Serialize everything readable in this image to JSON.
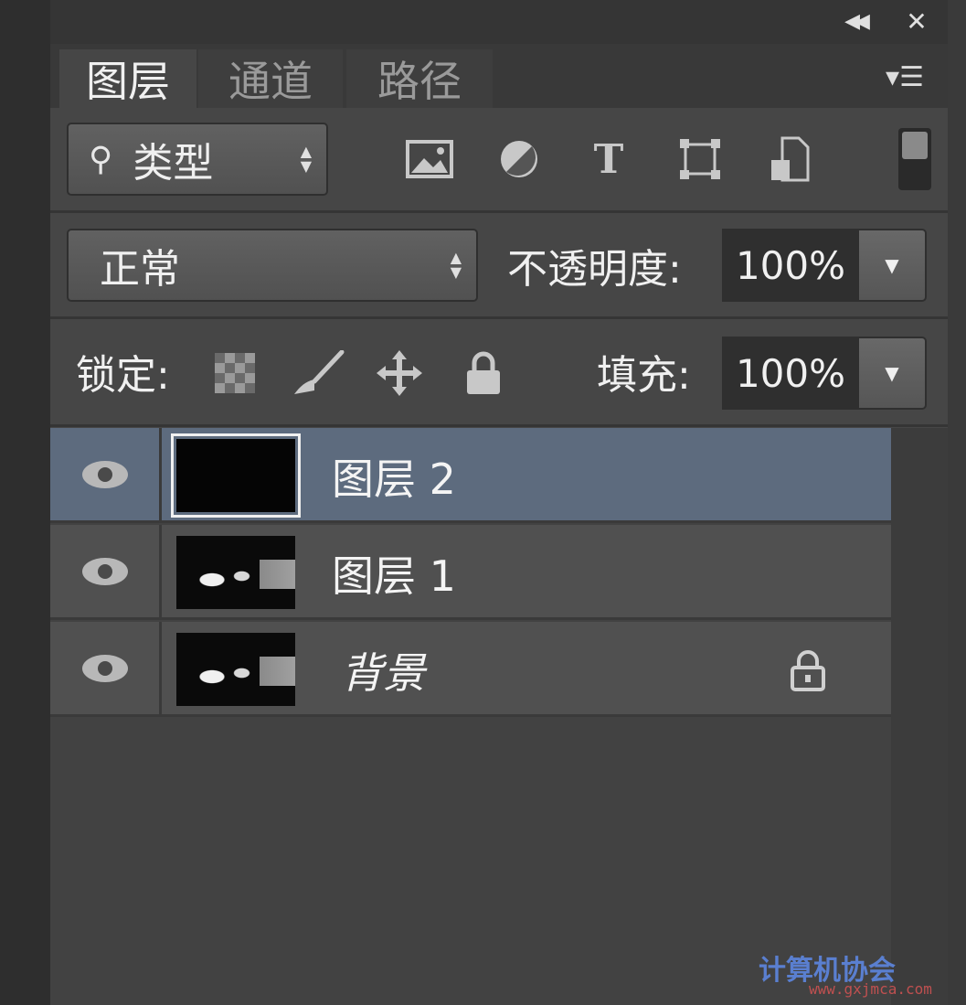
{
  "titlebar": {
    "collapse_glyph": "◀◀",
    "close_glyph": "✕"
  },
  "tabs": [
    {
      "label": "图层",
      "active": true
    },
    {
      "label": "通道",
      "active": false
    },
    {
      "label": "路径",
      "active": false
    }
  ],
  "panel_menu_glyph": "▾☰",
  "filter": {
    "kind_label": "类型",
    "icons": [
      "pixel-layer-filter-icon",
      "adjustment-layer-filter-icon",
      "type-layer-filter-icon",
      "shape-layer-filter-icon",
      "smart-object-filter-icon"
    ],
    "type_glyph": "T"
  },
  "blend": {
    "mode": "正常",
    "opacity_label": "不透明度:",
    "opacity_value": "100%"
  },
  "lock": {
    "label": "锁定:",
    "fill_label": "填充:",
    "fill_value": "100%"
  },
  "layers": [
    {
      "name": "图层 2",
      "selected": true,
      "visible": true,
      "locked": false
    },
    {
      "name": "图层 1",
      "selected": false,
      "visible": true,
      "locked": false
    },
    {
      "name": "背景",
      "selected": false,
      "visible": true,
      "locked": true
    }
  ],
  "watermark": {
    "text": "计算机协会",
    "url": "www.gxjmca.com"
  },
  "colors": {
    "panel_bg": "#464646",
    "selected_row": "#5d6b7e",
    "field_bg": "#2f2f2f"
  }
}
